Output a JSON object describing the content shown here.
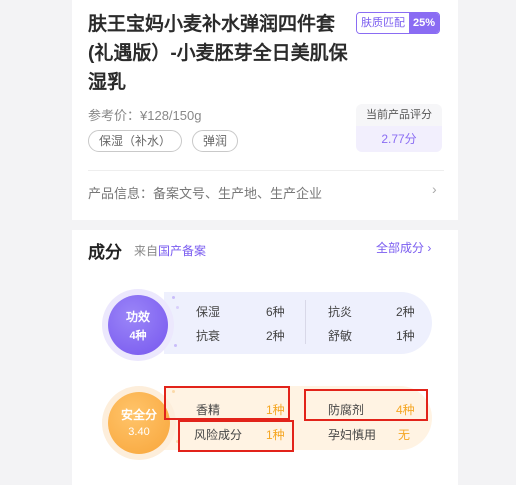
{
  "product": {
    "title": "肤王宝妈小麦补水弹润四件套(礼遇版）-小麦胚芽全日美肌保湿乳",
    "match_label": "肤质匹配",
    "match_value": "25%",
    "price": "参考价：¥128/150g",
    "tags": [
      "保湿（补水）",
      "弹润"
    ],
    "score_label": "当前产品评分",
    "score_value": "2.77分",
    "info": "产品信息：备案文号、生产地、生产企业"
  },
  "ingredients": {
    "title": "成分",
    "source_prefix": "来自",
    "source_highlight": "国产备案",
    "all_link": "全部成分 ›",
    "function": {
      "circle_label": "功效",
      "circle_count": "4种",
      "items": [
        {
          "name": "保湿",
          "count": "6种"
        },
        {
          "name": "抗衰",
          "count": "2种"
        },
        {
          "name": "抗炎",
          "count": "2种"
        },
        {
          "name": "舒敏",
          "count": "1种"
        }
      ]
    },
    "safety": {
      "circle_label": "安全分",
      "circle_score": "3.40",
      "items": [
        {
          "name": "香精",
          "count": "1种"
        },
        {
          "name": "风险成分",
          "count": "1种"
        },
        {
          "name": "防腐剂",
          "count": "4种"
        },
        {
          "name": "孕妇慎用",
          "count": "无"
        }
      ]
    }
  },
  "colors": {
    "accent": "#7a5cf0",
    "warning": "#f5a623",
    "annotation": "#e2231a"
  }
}
